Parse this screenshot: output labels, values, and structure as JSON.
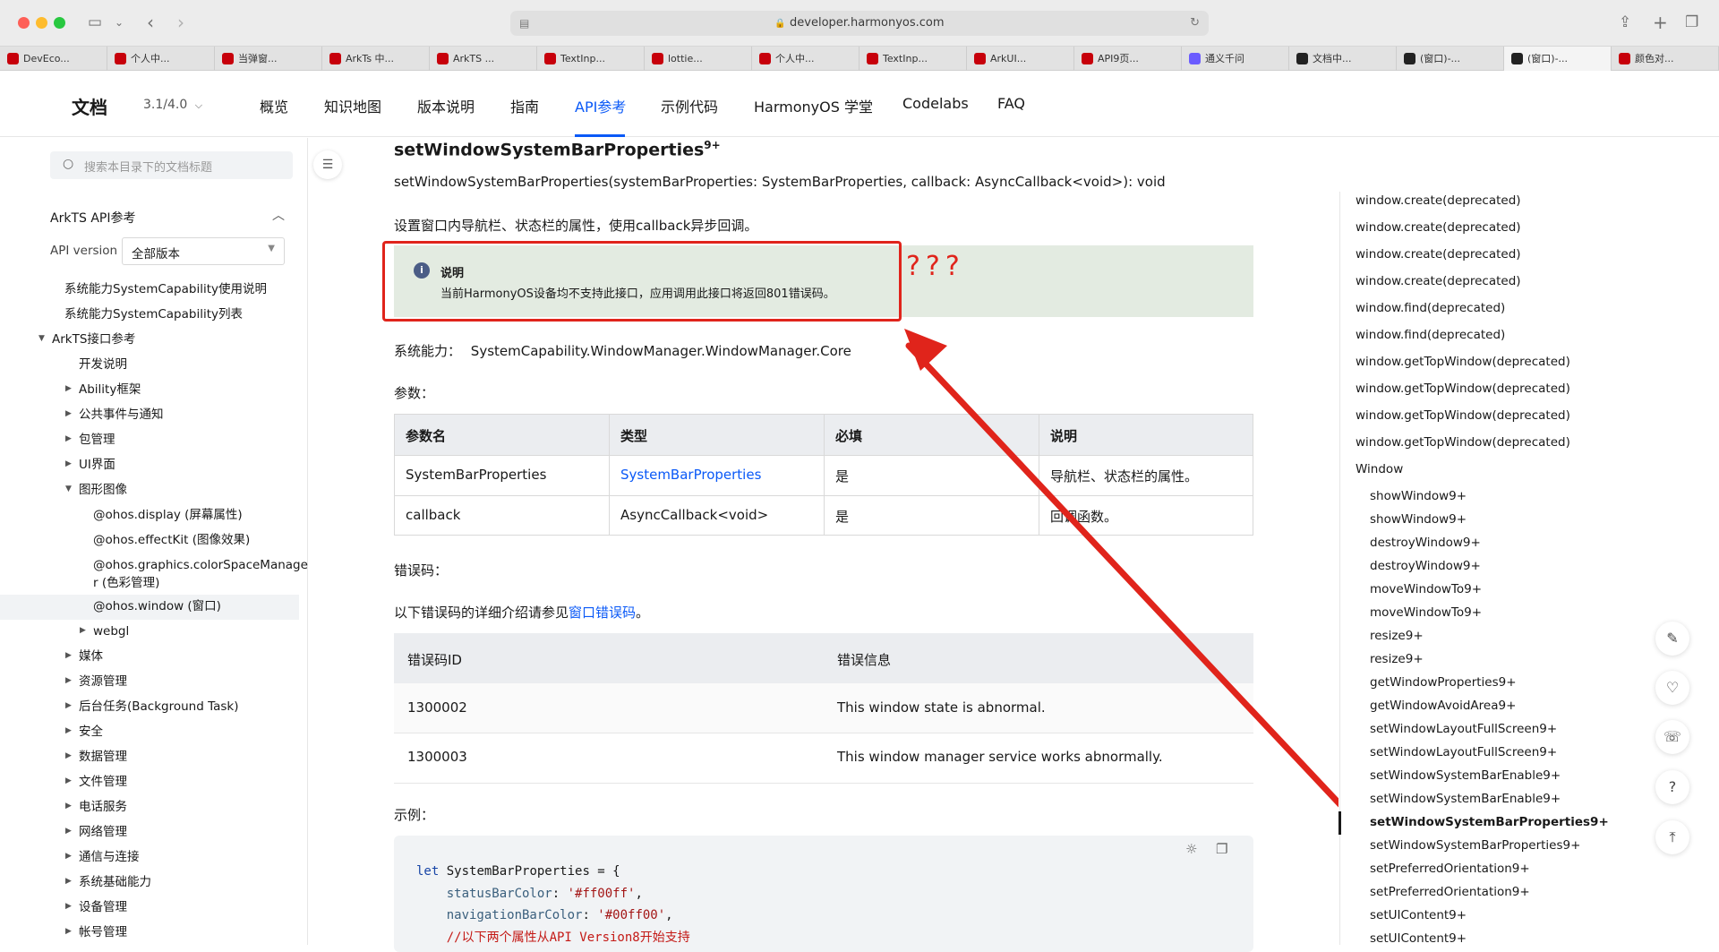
{
  "browser": {
    "url": "developer.harmonyos.com"
  },
  "tabs": [
    {
      "label": "DevEco...",
      "color": "#c7000b"
    },
    {
      "label": "个人中...",
      "color": "#c7000b"
    },
    {
      "label": "当弹窗...",
      "color": "#c7000b"
    },
    {
      "label": "ArkTs 中...",
      "color": "#c7000b"
    },
    {
      "label": "ArkTS ...",
      "color": "#c7000b"
    },
    {
      "label": "TextInp...",
      "color": "#c7000b"
    },
    {
      "label": "lottie...",
      "color": "#c7000b"
    },
    {
      "label": "个人中...",
      "color": "#c7000b"
    },
    {
      "label": "TextInp...",
      "color": "#c7000b"
    },
    {
      "label": "ArkUI...",
      "color": "#c7000b"
    },
    {
      "label": "API9页...",
      "color": "#c7000b"
    },
    {
      "label": "通义千问",
      "color": "#6b5cff"
    },
    {
      "label": "文档中...",
      "color": "#222222"
    },
    {
      "label": "(窗口)-...",
      "color": "#222222"
    },
    {
      "label": "(窗口)-...",
      "color": "#222222"
    },
    {
      "label": "颜色对...",
      "color": "#c7000b"
    }
  ],
  "header": {
    "title": "文档",
    "version": "3.1/4.0",
    "nav": [
      "概览",
      "知识地图",
      "版本说明",
      "指南",
      "API参考",
      "示例代码",
      "HarmonyOS 学堂",
      "Codelabs",
      "FAQ"
    ]
  },
  "sidebar": {
    "search_placeholder": "搜索本目录下的文档标题",
    "section": "ArkTS API参考",
    "api_version_label": "API version",
    "api_version_value": "全部版本",
    "items": [
      {
        "label": "系统能力SystemCapability使用说明",
        "level": 1,
        "arrow": ""
      },
      {
        "label": "系统能力SystemCapability列表",
        "level": 1,
        "arrow": ""
      },
      {
        "label": "ArkTS接口参考",
        "level": 0,
        "arrow": "down"
      },
      {
        "label": "开发说明",
        "level": 2,
        "arrow": ""
      },
      {
        "label": "Ability框架",
        "level": 2,
        "arrow": "right"
      },
      {
        "label": "公共事件与通知",
        "level": 2,
        "arrow": "right"
      },
      {
        "label": "包管理",
        "level": 2,
        "arrow": "right"
      },
      {
        "label": "UI界面",
        "level": 2,
        "arrow": "right"
      },
      {
        "label": "图形图像",
        "level": 2,
        "arrow": "down"
      },
      {
        "label": "@ohos.display (屏幕属性)",
        "level": 3,
        "arrow": ""
      },
      {
        "label": "@ohos.effectKit (图像效果)",
        "level": 3,
        "arrow": ""
      },
      {
        "label": "@ohos.graphics.colorSpaceManage",
        "label2": "r (色彩管理)",
        "level": 3,
        "arrow": ""
      },
      {
        "label": "@ohos.window (窗口)",
        "level": 3,
        "arrow": "",
        "selected": true
      },
      {
        "label": "webgl",
        "level": 3,
        "arrow": "right"
      },
      {
        "label": "媒体",
        "level": 2,
        "arrow": "right"
      },
      {
        "label": "资源管理",
        "level": 2,
        "arrow": "right"
      },
      {
        "label": "后台任务(Background Task)",
        "level": 2,
        "arrow": "right"
      },
      {
        "label": "安全",
        "level": 2,
        "arrow": "right"
      },
      {
        "label": "数据管理",
        "level": 2,
        "arrow": "right"
      },
      {
        "label": "文件管理",
        "level": 2,
        "arrow": "right"
      },
      {
        "label": "电话服务",
        "level": 2,
        "arrow": "right"
      },
      {
        "label": "网络管理",
        "level": 2,
        "arrow": "right"
      },
      {
        "label": "通信与连接",
        "level": 2,
        "arrow": "right"
      },
      {
        "label": "系统基础能力",
        "level": 2,
        "arrow": "right"
      },
      {
        "label": "设备管理",
        "level": 2,
        "arrow": "right"
      },
      {
        "label": "帐号管理",
        "level": 2,
        "arrow": "right"
      }
    ]
  },
  "main": {
    "heading": "setWindowSystemBarProperties",
    "heading_sup": "9+",
    "signature": "setWindowSystemBarProperties(systemBarProperties: SystemBarProperties, callback: AsyncCallback<void>): void",
    "description": "设置窗口内导航栏、状态栏的属性，使用callback异步回调。",
    "note_title": "说明",
    "note_text": "当前HarmonyOS设备均不支持此接口，应用调用此接口将返回801错误码。",
    "annotation": "???",
    "syscap_label": "系统能力：",
    "syscap_value": "SystemCapability.WindowManager.WindowManager.Core",
    "params_label": "参数：",
    "params_headers": [
      "参数名",
      "类型",
      "必填",
      "说明"
    ],
    "params_rows": [
      [
        "SystemBarProperties",
        "SystemBarProperties",
        "是",
        "导航栏、状态栏的属性。"
      ],
      [
        "callback",
        "AsyncCallback<void>",
        "是",
        "回调函数。"
      ]
    ],
    "errors_label": "错误码：",
    "errors_intro_pre": "以下错误码的详细介绍请参见",
    "errors_intro_link": "窗口错误码",
    "errors_intro_post": "。",
    "errors_headers": [
      "错误码ID",
      "错误信息"
    ],
    "errors_rows": [
      [
        "1300002",
        "This window state is abnormal."
      ],
      [
        "1300003",
        "This window manager service works abnormally."
      ]
    ],
    "example_label": "示例：",
    "code": {
      "kw": "let",
      "var": " SystemBarProperties = {",
      "p1": "statusBarColor",
      "v1": "'#ff00ff'",
      "p2": "navigationBarColor",
      "v2": "'#00ff00'",
      "comment": "//以下两个属性从API Version8开始支持"
    }
  },
  "toc": {
    "items": [
      "window.create(deprecated)",
      "window.create(deprecated)",
      "window.create(deprecated)",
      "window.create(deprecated)",
      "window.find(deprecated)",
      "window.find(deprecated)",
      "window.getTopWindow(deprecated)",
      "window.getTopWindow(deprecated)",
      "window.getTopWindow(deprecated)",
      "window.getTopWindow(deprecated)",
      "Window"
    ],
    "subitems": [
      "showWindow9+",
      "showWindow9+",
      "destroyWindow9+",
      "destroyWindow9+",
      "moveWindowTo9+",
      "moveWindowTo9+",
      "resize9+",
      "resize9+",
      "getWindowProperties9+",
      "getWindowAvoidArea9+",
      "setWindowLayoutFullScreen9+",
      "setWindowLayoutFullScreen9+",
      "setWindowSystemBarEnable9+",
      "setWindowSystemBarEnable9+",
      "setWindowSystemBarProperties9+",
      "setWindowSystemBarProperties9+",
      "setPreferredOrientation9+",
      "setPreferredOrientation9+",
      "setUIContent9+",
      "setUIContent9+"
    ],
    "active_index": 14
  },
  "colors": {
    "accent": "#0a59f7",
    "annotation_red": "#e0241b",
    "note_bg": "#e3ebe1"
  }
}
